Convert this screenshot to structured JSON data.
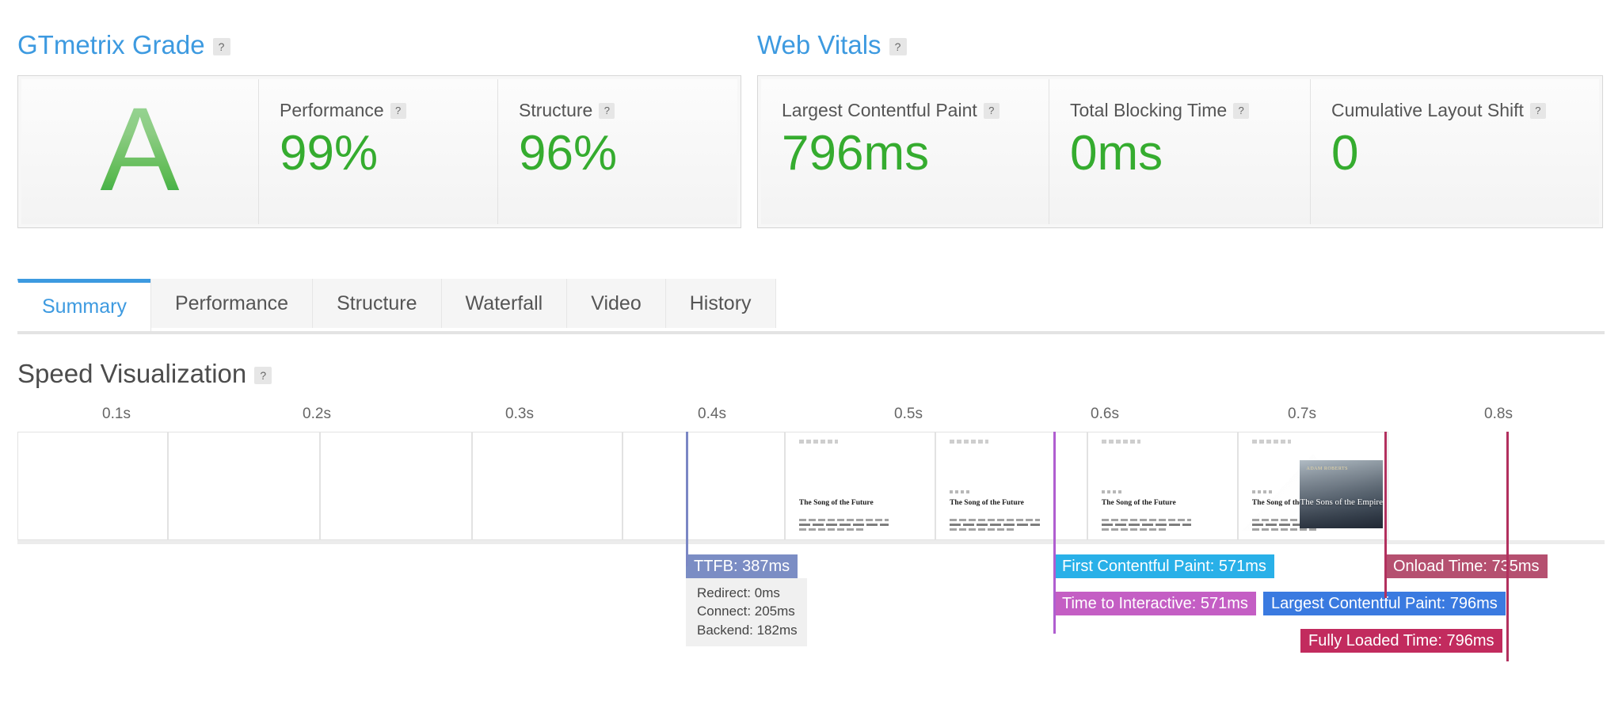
{
  "grade_panel": {
    "title": "GTmetrix Grade",
    "help": "?",
    "grade": "A",
    "metrics": [
      {
        "label": "Performance",
        "value": "99%",
        "help": "?"
      },
      {
        "label": "Structure",
        "value": "96%",
        "help": "?"
      }
    ]
  },
  "vitals_panel": {
    "title": "Web Vitals",
    "help": "?",
    "metrics": [
      {
        "label": "Largest Contentful Paint",
        "value": "796ms",
        "help": "?"
      },
      {
        "label": "Total Blocking Time",
        "value": "0ms",
        "help": "?"
      },
      {
        "label": "Cumulative Layout Shift",
        "value": "0",
        "help": "?"
      }
    ]
  },
  "tabs": {
    "active": "Summary",
    "items": [
      {
        "label": "Summary"
      },
      {
        "label": "Performance"
      },
      {
        "label": "Structure"
      },
      {
        "label": "Waterfall"
      },
      {
        "label": "Video"
      },
      {
        "label": "History"
      }
    ]
  },
  "speed_visualization": {
    "title": "Speed Visualization",
    "help": "?",
    "axis_ticks": [
      "0.1s",
      "0.2s",
      "0.3s",
      "0.4s",
      "0.5s",
      "0.6s",
      "0.7s",
      "0.8s"
    ],
    "frames": [
      {
        "state": "blank"
      },
      {
        "state": "blank"
      },
      {
        "state": "blank"
      },
      {
        "state": "blank"
      },
      {
        "state": "blank"
      },
      {
        "state": "text"
      },
      {
        "state": "text-kicker"
      },
      {
        "state": "text-kicker"
      },
      {
        "state": "cover"
      }
    ],
    "page_thumbnail": {
      "heading": "The Song of the Future",
      "cover_author": "ADAM ROBERTS",
      "cover_title": "The Sons of the Empire"
    },
    "markers": [
      {
        "name": "ttfb",
        "color": "#7b87c4"
      },
      {
        "name": "fcp-tti",
        "color": "#b05ed0"
      },
      {
        "name": "onload",
        "color": "#b2305e"
      },
      {
        "name": "lcp-fully-loaded",
        "color": "#b2305e"
      }
    ],
    "events": [
      {
        "name": "ttfb",
        "label": "TTFB: 387ms",
        "color": "#7b8dc4"
      },
      {
        "name": "first-contentful-paint",
        "label": "First Contentful Paint: 571ms",
        "color": "#29b0e8"
      },
      {
        "name": "time-to-interactive",
        "label": "Time to Interactive: 571ms",
        "color": "#c45ec4"
      },
      {
        "name": "onload-time",
        "label": "Onload Time: 735ms",
        "color": "#b55070"
      },
      {
        "name": "largest-contentful-paint",
        "label": "Largest Contentful Paint: 796ms",
        "color": "#3a7ae0"
      },
      {
        "name": "fully-loaded-time",
        "label": "Fully Loaded Time: 796ms",
        "color": "#c22b5e"
      }
    ],
    "ttfb_breakdown": [
      "Redirect: 0ms",
      "Connect: 205ms",
      "Backend: 182ms"
    ]
  }
}
